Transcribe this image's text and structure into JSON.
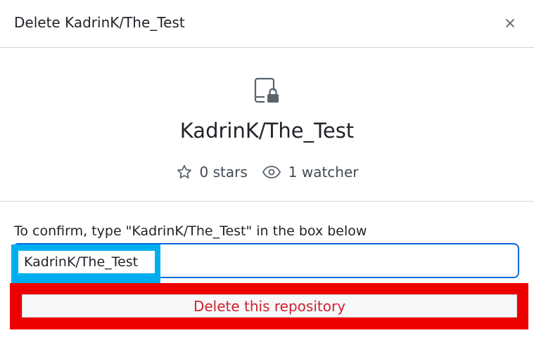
{
  "dialog": {
    "title": "Delete KadrinK/The_Test",
    "close_icon": "x-icon"
  },
  "repo": {
    "icon": "repo-locked-icon",
    "name": "KadrinK/The_Test",
    "stars_icon": "star-icon",
    "stars": "0 stars",
    "watchers_icon": "eye-icon",
    "watchers": "1 watcher"
  },
  "confirm": {
    "label": "To confirm, type \"KadrinK/The_Test\" in the box below",
    "input_value": "KadrinK/The_Test",
    "button_label": "Delete this repository"
  },
  "colors": {
    "danger_text": "#cf222e",
    "focus_border": "#0969da",
    "annotation_blue": "#00aeef",
    "annotation_red": "#ee0000"
  }
}
